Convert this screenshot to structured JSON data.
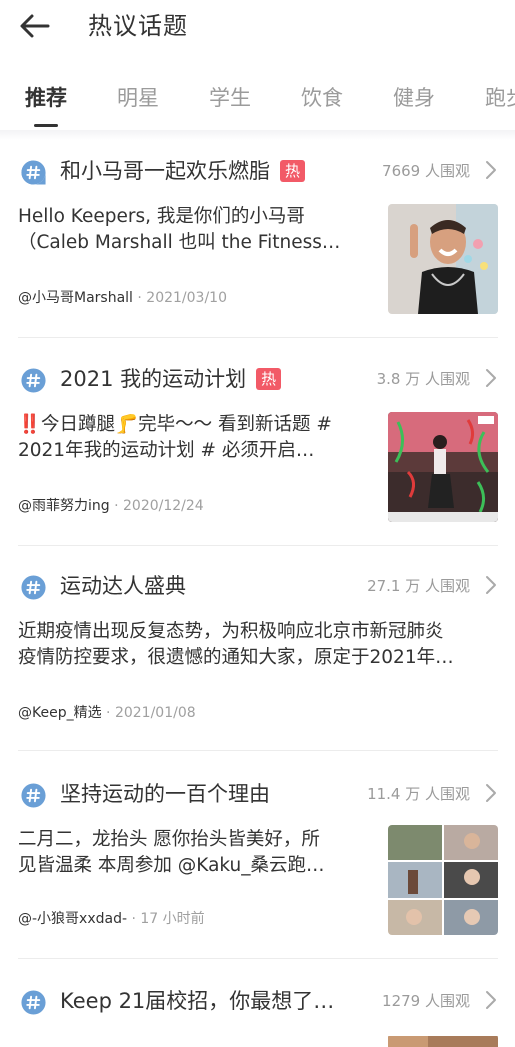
{
  "header": {
    "title": "热议话题",
    "back_icon": "arrow-left-icon"
  },
  "tabs": [
    {
      "label": "推荐",
      "active": true
    },
    {
      "label": "明星",
      "active": false
    },
    {
      "label": "学生",
      "active": false
    },
    {
      "label": "饮食",
      "active": false
    },
    {
      "label": "健身",
      "active": false
    },
    {
      "label": "跑步",
      "active": false
    }
  ],
  "colors": {
    "hot_badge": "#f25a67",
    "hash_icon": "#6a9fd6",
    "muted": "#9b9b9b"
  },
  "topics": [
    {
      "title": "和小马哥一起欢乐燃脂",
      "hot": "热",
      "views": "7669 人围观",
      "desc_line1": "Hello Keepers, 我是你们的小马哥",
      "desc_line2": "（Caleb Marshall 也叫 the Fitness…",
      "author": "@小马哥Marshall",
      "date": " · 2021/03/10"
    },
    {
      "title": "2021 我的运动计划",
      "hot": "热",
      "views": "3.8 万 人围观",
      "desc_line1": "‼️今日蹲腿🦵完毕～～  看到新话题 #",
      "desc_line2": "2021年我的运动计划 # 必须开启…",
      "author": "@雨菲努力ing",
      "date": " · 2020/12/24"
    },
    {
      "title": "运动达人盛典",
      "views": "27.1 万 人围观",
      "desc_line1": "近期疫情出现反复态势，为积极响应北京市新冠肺炎",
      "desc_line2": "疫情防控要求，很遗憾的通知大家，原定于2021年…",
      "author": "@Keep_精选",
      "date": " · 2021/01/08"
    },
    {
      "title": "坚持运动的一百个理由",
      "views": "11.4 万 人围观",
      "desc_line1": "二月二，龙抬头 愿你抬头皆美好，所",
      "desc_line2": "见皆温柔 本周参加 @Kaku_桑云跑…",
      "author": "@-小狼哥xxdad-",
      "date": " · 17 小时前"
    },
    {
      "title": "Keep 21届校招，你最想了…",
      "views": "1279 人围观"
    }
  ]
}
